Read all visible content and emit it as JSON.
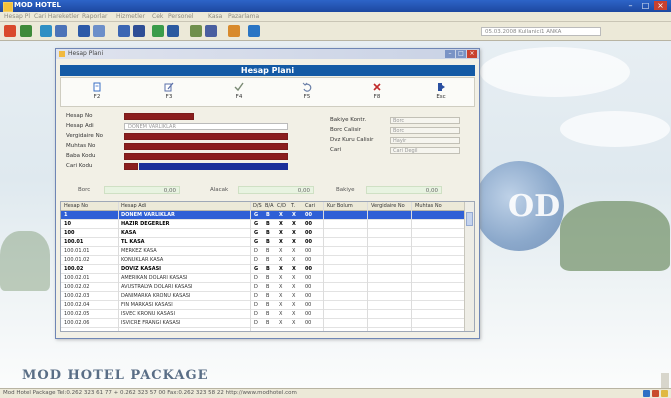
{
  "app": {
    "title": "MOD HOTEL",
    "menu": [
      "Hesap Pl",
      "Cari Hareketler",
      "Raporlar",
      "Hizmetler",
      "Cek",
      "Personel",
      "Kasa",
      "Pazarlama"
    ],
    "toolbar_info": "05.03.2008 Kullanici1 ANKA"
  },
  "window": {
    "title": "Hesap Plani",
    "banner": "Hesap Plani",
    "actions": [
      {
        "id": "new",
        "label": "F2",
        "icon": "new-document-icon",
        "color": "#3a6fc4"
      },
      {
        "id": "edit",
        "label": "F3",
        "icon": "edit-pencil-icon",
        "color": "#5a6fa8"
      },
      {
        "id": "save",
        "label": "F4",
        "icon": "save-check-icon",
        "color": "#7a8a74"
      },
      {
        "id": "undo",
        "label": "F5",
        "icon": "undo-icon",
        "color": "#6a7fa8"
      },
      {
        "id": "delete",
        "label": "F8",
        "icon": "delete-x-icon",
        "color": "#c02b2b"
      },
      {
        "id": "exit",
        "label": "Esc",
        "icon": "exit-door-icon",
        "color": "#2a4fa0"
      }
    ]
  },
  "form": {
    "labels": {
      "hesap_no": "Hesap No",
      "hesap_adi": "Hesap Adi",
      "vergi_no": "Vergidaire No",
      "muhtas_no": "Muhtas No",
      "baba_kodu": "Baba Kodu",
      "cari_kodu": "Cari Kodu",
      "bakiye_kont": "Bakiye Kontr.",
      "borc_calisir": "Borc Calisir",
      "doviz_kuru": "Dvz Kuru Calisir",
      "cari": "Cari"
    },
    "values": {
      "hesap_adi": "DONEM VARLIKLAR",
      "bakiye_kont": "Borc",
      "borc_calisir": "Borc",
      "doviz_kuru": "Hayir",
      "cari": "Cari Degil"
    }
  },
  "summary": {
    "borc_label": "Borc",
    "borc_value": "0,00",
    "alacak_label": "Alacak",
    "alacak_value": "0,00",
    "bakiye_label": "Bakiye",
    "bakiye_value": "0,00"
  },
  "grid": {
    "columns": [
      "Hesap No",
      "Hesap Adi",
      "D/S",
      "B/A",
      "C/D",
      "T.",
      "Cari",
      "Kur Bolum",
      "Vergidaire No",
      "Muhtas No"
    ],
    "rows": [
      {
        "no": "1",
        "name": "DONEM VARLIKLAR",
        "ds": "G",
        "ba": "B",
        "cd": "X",
        "t": "X",
        "cari": "00",
        "selected": true,
        "bold": true
      },
      {
        "no": "10",
        "name": "HAZIR DEGERLER",
        "ds": "G",
        "ba": "B",
        "cd": "X",
        "t": "X",
        "cari": "00",
        "bold": true
      },
      {
        "no": "100",
        "name": "KASA",
        "ds": "G",
        "ba": "B",
        "cd": "X",
        "t": "X",
        "cari": "00",
        "bold": true
      },
      {
        "no": "100.01",
        "name": "TL KASA",
        "ds": "G",
        "ba": "B",
        "cd": "X",
        "t": "X",
        "cari": "00",
        "bold": true
      },
      {
        "no": "100.01.01",
        "name": "MERKEZ KASA",
        "ds": "D",
        "ba": "B",
        "cd": "X",
        "t": "X",
        "cari": "00"
      },
      {
        "no": "100.01.02",
        "name": "KONUKLAR KASA",
        "ds": "D",
        "ba": "B",
        "cd": "X",
        "t": "X",
        "cari": "00"
      },
      {
        "no": "100.02",
        "name": "DOVIZ KASASI",
        "ds": "G",
        "ba": "B",
        "cd": "X",
        "t": "X",
        "cari": "00",
        "bold": true
      },
      {
        "no": "100.02.01",
        "name": "AMERIKAN DOLARI KASASI",
        "ds": "D",
        "ba": "B",
        "cd": "X",
        "t": "X",
        "cari": "00"
      },
      {
        "no": "100.02.02",
        "name": "AVUSTRALYA DOLARI KASASI",
        "ds": "D",
        "ba": "B",
        "cd": "X",
        "t": "X",
        "cari": "00"
      },
      {
        "no": "100.02.03",
        "name": "DANIMARKA KRONU KASASI",
        "ds": "D",
        "ba": "B",
        "cd": "X",
        "t": "X",
        "cari": "00"
      },
      {
        "no": "100.02.04",
        "name": "FIN MARKASI KASASI",
        "ds": "D",
        "ba": "B",
        "cd": "X",
        "t": "X",
        "cari": "00"
      },
      {
        "no": "100.02.05",
        "name": "ISVEC KRONU KASASI",
        "ds": "D",
        "ba": "B",
        "cd": "X",
        "t": "X",
        "cari": "00"
      },
      {
        "no": "100.02.06",
        "name": "ISVICRE FRANGI KASASI",
        "ds": "D",
        "ba": "B",
        "cd": "X",
        "t": "X",
        "cari": "00"
      }
    ]
  },
  "desktop": {
    "brand": "MOD HOTEL PACKAGE",
    "globe_text": "OD"
  },
  "statusbar": {
    "text": "Mod Hotel Package   Tel:0.262 323 61 77 + 0.262 323 57 00   Fax:0.262 323 58 22   http://www.modhotel.com"
  },
  "colors": {
    "banner": "#145aa5",
    "selected_row": "#2f5fd6",
    "required_field": "#8b1e1e",
    "cari_field": "#1b2f9a"
  }
}
